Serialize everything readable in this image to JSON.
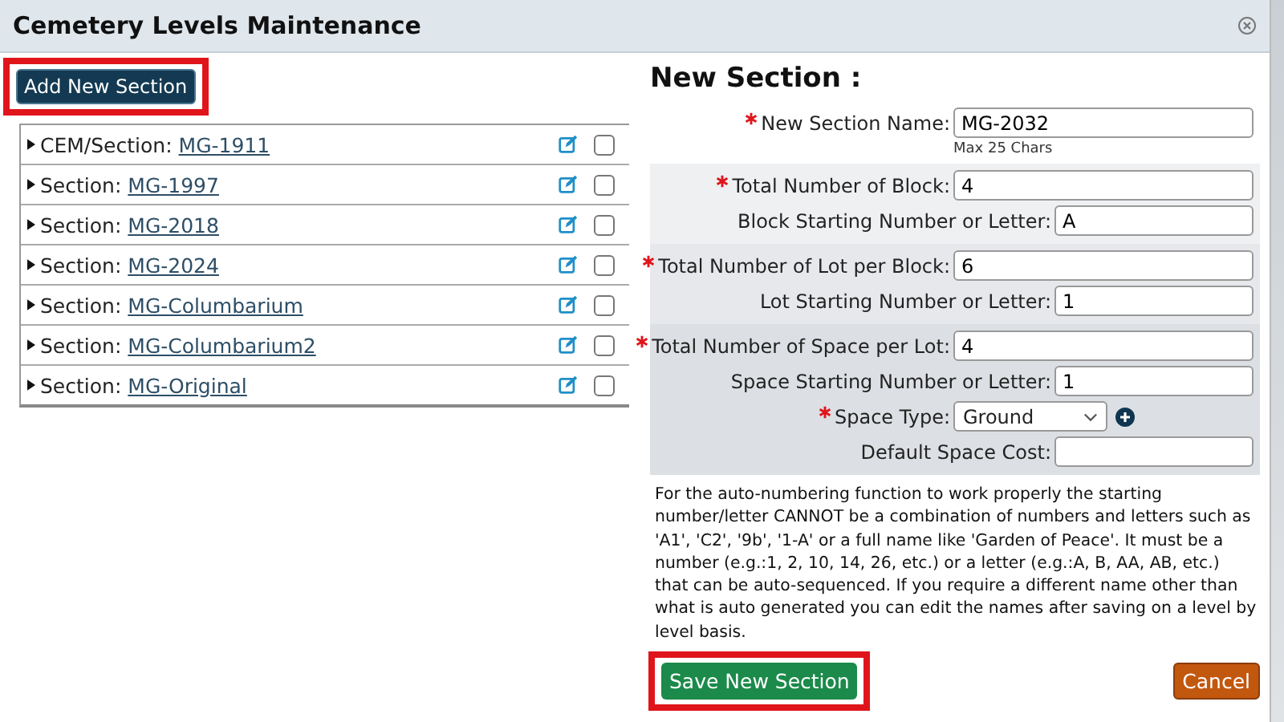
{
  "window": {
    "title": "Cemetery Levels Maintenance"
  },
  "add_button": {
    "label": "Add New Section",
    "highlighted": true
  },
  "sections": [
    {
      "prefix": "CEM/Section:",
      "name": "MG-1911",
      "checked": false
    },
    {
      "prefix": "Section:",
      "name": "MG-1997",
      "checked": false
    },
    {
      "prefix": "Section:",
      "name": "MG-2018",
      "checked": false
    },
    {
      "prefix": "Section:",
      "name": "MG-2024",
      "checked": false
    },
    {
      "prefix": "Section:",
      "name": "MG-Columbarium",
      "checked": false
    },
    {
      "prefix": "Section:",
      "name": "MG-Columbarium2",
      "checked": false
    },
    {
      "prefix": "Section:",
      "name": "MG-Original",
      "checked": false
    }
  ],
  "form": {
    "title": "New Section :",
    "groups": [
      {
        "fields": [
          {
            "kind": "text",
            "label": "New Section Name:",
            "required": true,
            "value": "MG-2032",
            "hint": "Max 25 Chars"
          }
        ]
      },
      {
        "fields": [
          {
            "kind": "text",
            "label": "Total Number of Block:",
            "required": true,
            "value": "4"
          },
          {
            "kind": "text",
            "label": "Block Starting Number or Letter:",
            "required": false,
            "value": "A"
          }
        ]
      },
      {
        "fields": [
          {
            "kind": "text",
            "label": "Total Number of Lot per Block:",
            "required": true,
            "value": "6"
          },
          {
            "kind": "text",
            "label": "Lot Starting Number or Letter:",
            "required": false,
            "value": "1"
          }
        ]
      },
      {
        "fields": [
          {
            "kind": "text",
            "label": "Total Number of Space per Lot:",
            "required": true,
            "value": "4"
          },
          {
            "kind": "text",
            "label": "Space Starting Number or Letter:",
            "required": false,
            "value": "1"
          },
          {
            "kind": "select",
            "label": "Space Type:",
            "required": true,
            "value": "Ground"
          },
          {
            "kind": "text",
            "label": "Default Space Cost:",
            "required": false
          }
        ]
      }
    ],
    "note": "For the auto-numbering function to work properly the starting number/letter CANNOT be a combination of numbers and letters such as 'A1', 'C2', '9b', '1-A' or a full name like 'Garden of Peace'. It must be a number (e.g.:1, 2, 10, 14, 26, etc.) or a letter (e.g.:A, B, AA, AB, etc.) that can be auto-sequenced. If you require a different name other than what is auto generated you can edit the names after saving on a level by level basis.",
    "save_button": {
      "label": "Save New Section",
      "highlighted": true
    },
    "cancel_button": {
      "label": "Cancel"
    }
  }
}
